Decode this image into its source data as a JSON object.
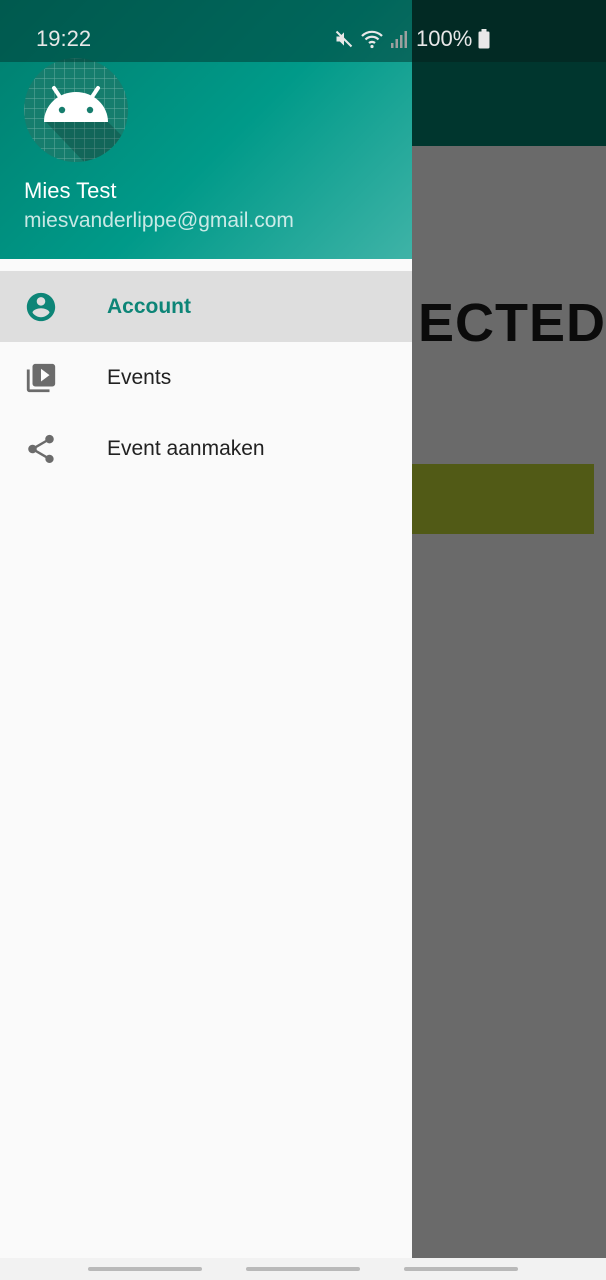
{
  "status_bar": {
    "time": "19:22",
    "battery": "100%",
    "icons": [
      "mute-icon",
      "wifi-icon",
      "signal-icon",
      "battery-icon"
    ]
  },
  "background_app": {
    "partial_text": "ECTED"
  },
  "drawer": {
    "header": {
      "name": "Mies Test",
      "email": "miesvanderlippe@gmail.com",
      "avatar_icon": "android-icon"
    },
    "items": [
      {
        "label": "Account",
        "icon": "account-circle-icon",
        "active": true
      },
      {
        "label": "Events",
        "icon": "video-library-icon",
        "active": false
      },
      {
        "label": "Event aanmaken",
        "icon": "share-icon",
        "active": false
      }
    ]
  },
  "colors": {
    "accent": "#0d8577",
    "header_start": "#007e6e",
    "header_end": "#3fb3a7",
    "scrim": "#6a6a6a"
  }
}
